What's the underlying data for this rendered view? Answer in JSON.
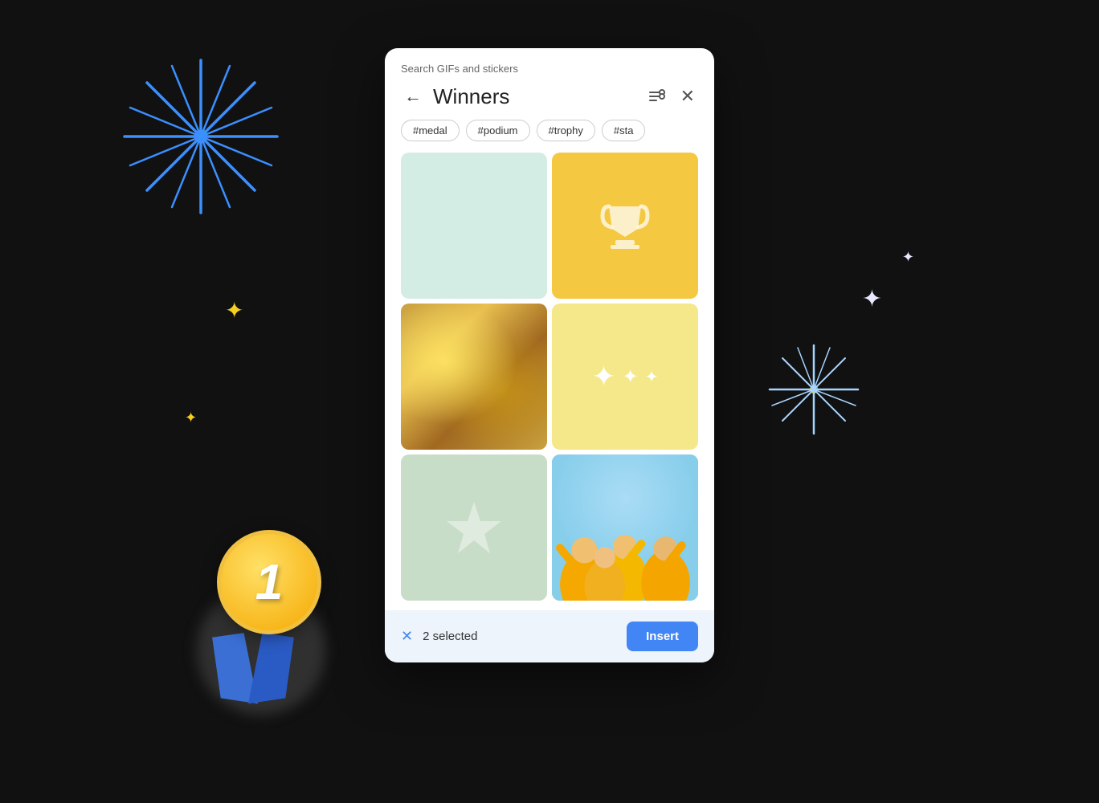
{
  "dialog": {
    "search_label": "Search GIFs and stickers",
    "title": "Winners",
    "filter_icon": "⚙",
    "close_icon": "✕",
    "back_icon": "←"
  },
  "tags": [
    {
      "label": "#medal"
    },
    {
      "label": "#podium"
    },
    {
      "label": "#trophy"
    },
    {
      "label": "#sta"
    }
  ],
  "grid": {
    "cells": [
      {
        "type": "mint",
        "alt": "green background gif"
      },
      {
        "type": "yellow-trophy",
        "alt": "trophy gif"
      },
      {
        "type": "gold-shimmer",
        "alt": "gold glitter gif"
      },
      {
        "type": "cream-sparkles",
        "alt": "sparkles gif"
      },
      {
        "type": "sage-star",
        "alt": "star gif"
      },
      {
        "type": "people-photo",
        "alt": "people celebrating gif"
      }
    ]
  },
  "bottom_bar": {
    "clear_icon": "✕",
    "selected_text": "2 selected",
    "insert_label": "Insert"
  },
  "decorations": {
    "medal_number": "1"
  }
}
